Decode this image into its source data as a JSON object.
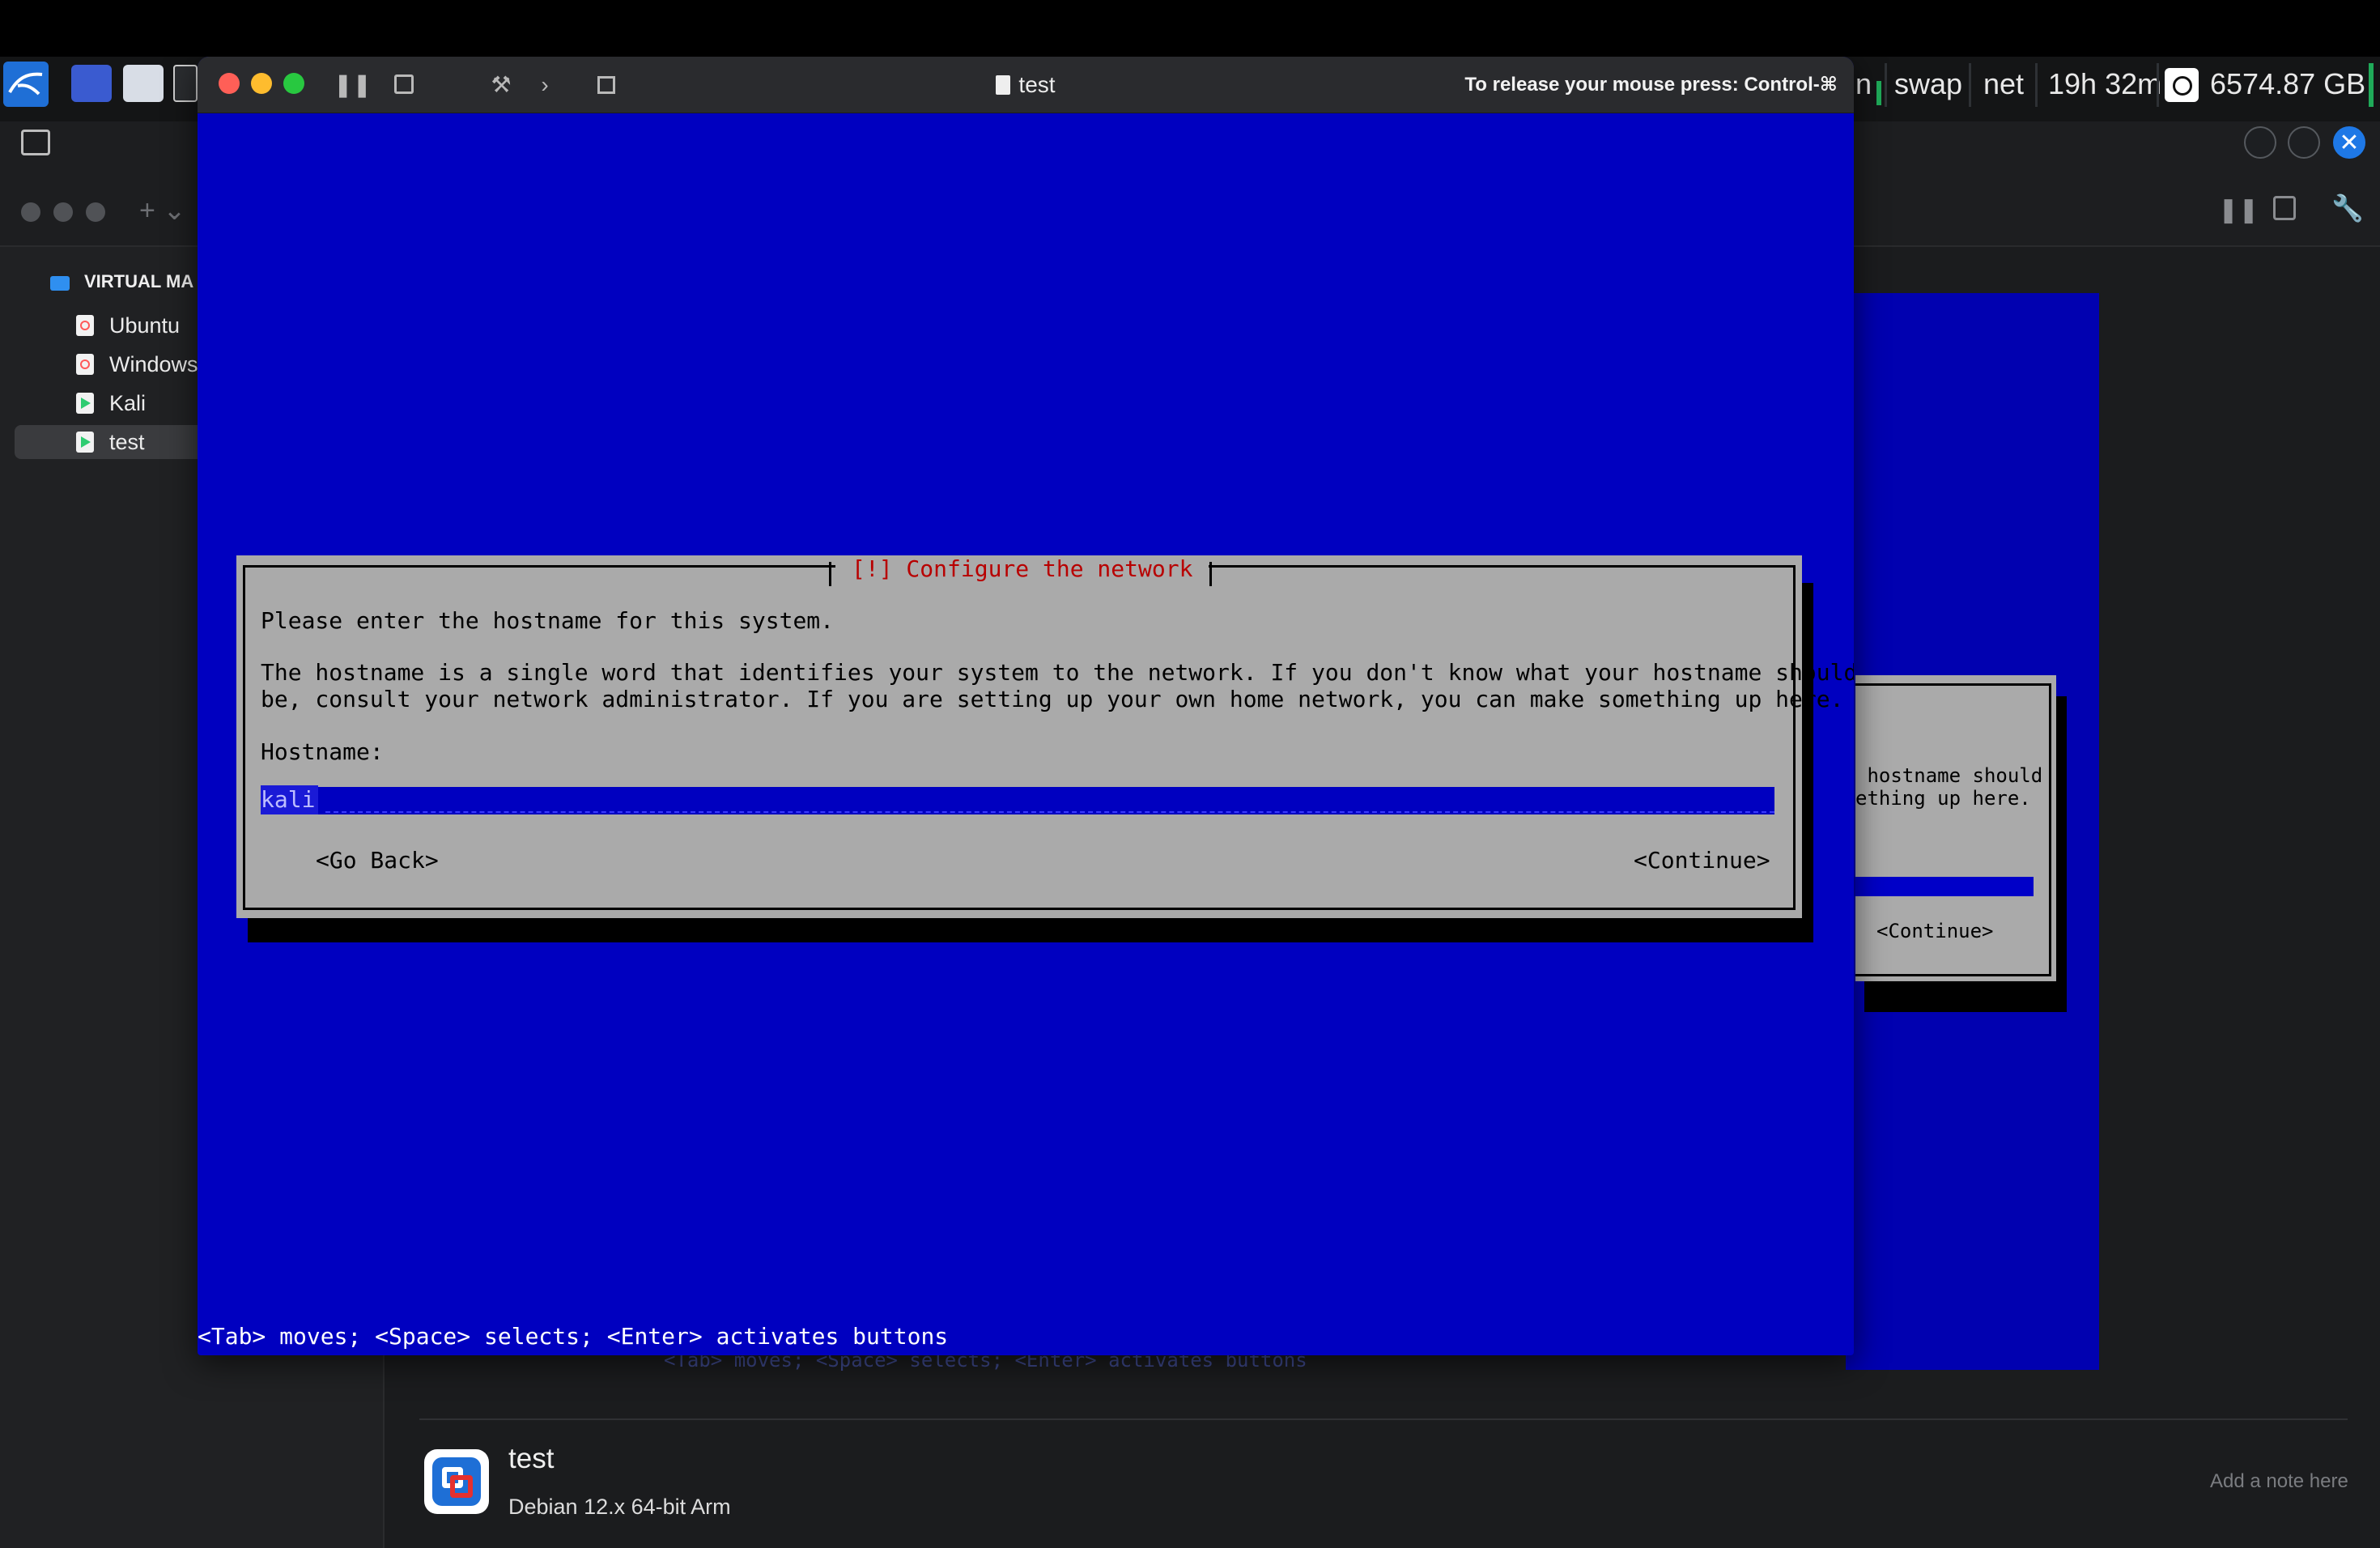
{
  "host_bar": {
    "stats": [
      "n",
      "swap",
      "net",
      "19h 32m",
      "6574.87 GB"
    ]
  },
  "library": {
    "section_title": "VIRTUAL MA",
    "items": [
      {
        "label": "Ubuntu",
        "icon": "vm-icon",
        "color": "#ff5a5a"
      },
      {
        "label": "Windows",
        "icon": "vm-icon",
        "color": "#ff5a5a"
      },
      {
        "label": "Kali",
        "icon": "vm-running-icon",
        "color": "#2ecc71"
      },
      {
        "label": "test",
        "icon": "vm-running-icon",
        "color": "#2ecc71"
      }
    ],
    "selected_vm": {
      "name": "test",
      "description": "Debian 12.x 64-bit Arm",
      "note_placeholder": "Add a note here"
    },
    "preview": {
      "text_lines": [
        " hostname should",
        "ething up here."
      ],
      "continue_label": "<Continue>",
      "status_hint": "<Tab> moves; <Space> selects; <Enter> activates buttons"
    }
  },
  "vm_window": {
    "title": "test",
    "release_hint": "To release your mouse press: Control-⌘",
    "colors": {
      "screen": "#0000c0",
      "dialog": "#aaaaaa",
      "title_text": "#b80000"
    }
  },
  "installer": {
    "dialog_title": "[!] Configure the network",
    "prompt": "Please enter the hostname for this system.",
    "description_line1": "The hostname is a single word that identifies your system to the network. If you don't know what your hostname should",
    "description_line2": "be, consult your network administrator. If you are setting up your own home network, you can make something up here.",
    "field_label": "Hostname:",
    "hostname_value": "kali",
    "go_back_label": "<Go Back>",
    "continue_label": "<Continue>",
    "status_hint": "<Tab> moves; <Space> selects; <Enter> activates buttons"
  }
}
